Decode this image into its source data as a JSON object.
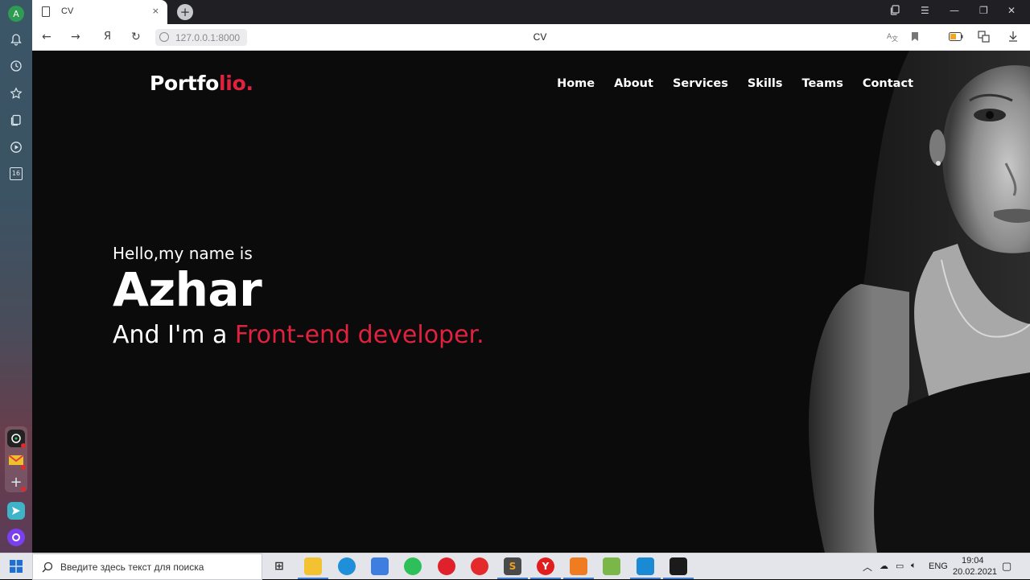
{
  "browser": {
    "profile_initial": "A",
    "tab": {
      "title": "CV",
      "close": "×"
    },
    "new_tab": "+",
    "nav": {
      "back": "←",
      "forward": "→",
      "yandex": "Я",
      "reload": "↻"
    },
    "url": "127.0.0.1:8000",
    "page_title": "CV",
    "notification_count": "16"
  },
  "page": {
    "logo_main": "Portfo",
    "logo_accent": "lio.",
    "menu": [
      "Home",
      "About",
      "Services",
      "Skills",
      "Teams",
      "Contact"
    ],
    "hero": {
      "greeting": "Hello,my name is",
      "name": "Azhar",
      "role_prefix": "And I'm a ",
      "role_accent": "Front-end developer."
    },
    "colors": {
      "accent": "#e0223f",
      "background": "#0b0b0c"
    }
  },
  "taskbar": {
    "search_placeholder": "Введите здесь текст для поиска",
    "language": "ENG",
    "time": "19:04",
    "date": "20.02.2021"
  }
}
